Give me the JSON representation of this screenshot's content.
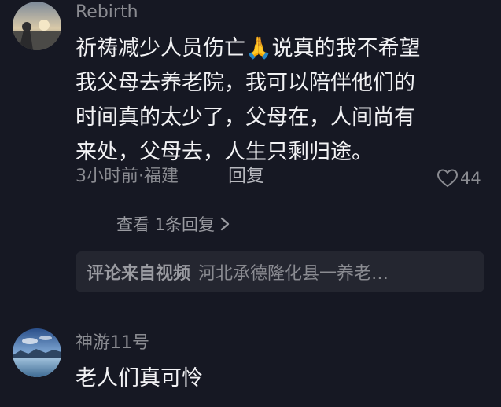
{
  "comments": [
    {
      "username": "Rebirth",
      "text_lines": [
        "祈祷减少人员伤亡🙏说真的我不希望",
        "我父母去养老院，我可以陪伴他们的",
        "时间真的太少了，父母在，人间尚有",
        "来处，父母去，人生只剩归途。"
      ],
      "meta": "3小时前·福建",
      "reply_label": "回复",
      "like_count": "44",
      "view_replies_label": "查看 1条回复",
      "avatar_icon": "sunset-avatar-icon"
    },
    {
      "username": "神游11号",
      "text_lines": [
        "老人们真可怜"
      ],
      "avatar_icon": "lake-landscape-avatar-icon"
    }
  ],
  "source_card": {
    "label": "评论来自视频",
    "title": "河北承德隆化县一养老…"
  },
  "colors": {
    "background": "#161823",
    "primary_text": "#f2f2f4",
    "secondary_text": "#8a8b91",
    "card_background": "#242630"
  }
}
